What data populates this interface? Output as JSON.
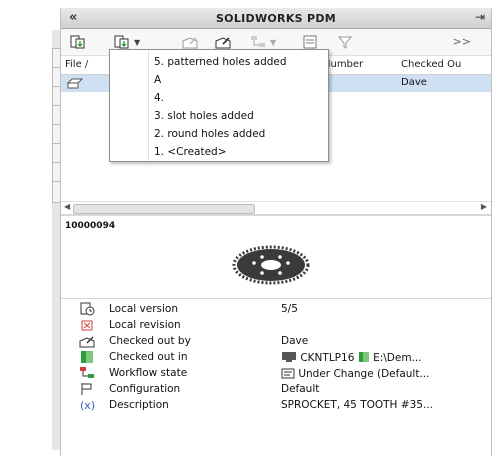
{
  "panel": {
    "collapse_glyph": "«",
    "title": "SOLIDWORKS PDM",
    "pin_glyph": "⇥",
    "more_glyph": ">>"
  },
  "toolbar": {
    "icons": [
      "get-latest-icon",
      "get-version-icon",
      "check-out-icon",
      "check-in-icon",
      "change-state-icon",
      "properties-icon",
      "search-icon"
    ]
  },
  "columns": {
    "file": "File /",
    "number": "Number",
    "checked_out": "Checked Ou"
  },
  "selected_row": {
    "user": "Dave"
  },
  "version_menu": {
    "items": [
      "5. patterned holes added",
      "A",
      "4.",
      "3. slot holes added",
      "2. round holes added",
      "1. <Created>"
    ]
  },
  "preview": {
    "doc_number": "10000094"
  },
  "properties": [
    {
      "label": "Local version",
      "value": "5/5"
    },
    {
      "label": "Local revision",
      "value": ""
    },
    {
      "label": "Checked out by",
      "value": "Dave"
    },
    {
      "label": "Checked out in",
      "value_computer": "CKNTLP16",
      "value_path": "E:\\Dem..."
    },
    {
      "label": "Workflow state",
      "value": "Under Change (Default..."
    },
    {
      "label": "Configuration",
      "value": "Default"
    },
    {
      "label": "Description",
      "value": "SPROCKET, 45 TOOTH #35..."
    }
  ],
  "colors": {
    "selection": "#cfe0f3",
    "accent_green": "#2e9e3a",
    "accent_red": "#d33c3c"
  }
}
